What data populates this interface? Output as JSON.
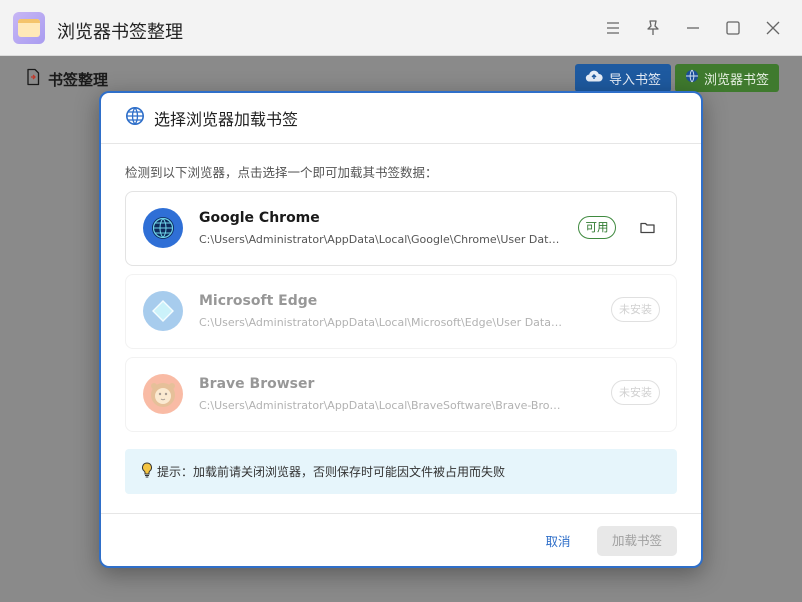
{
  "window": {
    "title": "浏览器书签整理"
  },
  "toolbar": {
    "page_heading": "书签整理",
    "import_label": "导入书签",
    "browser_label": "浏览器书签",
    "import_color": "#1e5aa0",
    "browser_color": "#3f7a2e"
  },
  "dialog": {
    "title": "选择浏览器加载书签",
    "description": "检测到以下浏览器，点击选择一个即可加载其书签数据：",
    "browsers": [
      {
        "name": "Google Chrome",
        "path": "C:\\Users\\Administrator\\AppData\\Local\\Google\\Chrome\\User Data\\Default\\Bookmarks",
        "status": "可用",
        "available": true,
        "icon": "chrome-globe-icon"
      },
      {
        "name": "Microsoft Edge",
        "path": "C:\\Users\\Administrator\\AppData\\Local\\Microsoft\\Edge\\User Data\\Default\\Bookmarks",
        "status": "未安装",
        "available": false,
        "icon": "edge-diamond-icon"
      },
      {
        "name": "Brave Browser",
        "path": "C:\\Users\\Administrator\\AppData\\Local\\BraveSoftware\\Brave-Browser\\User Data\\Default\\Bookmarks",
        "status": "未安装",
        "available": false,
        "icon": "brave-lion-icon"
      }
    ],
    "tip": "提示：加载前请关闭浏览器，否则保存时可能因文件被占用而失败",
    "cancel_label": "取消",
    "load_label": "加载书签",
    "accent_color": "#2f6fc9"
  }
}
